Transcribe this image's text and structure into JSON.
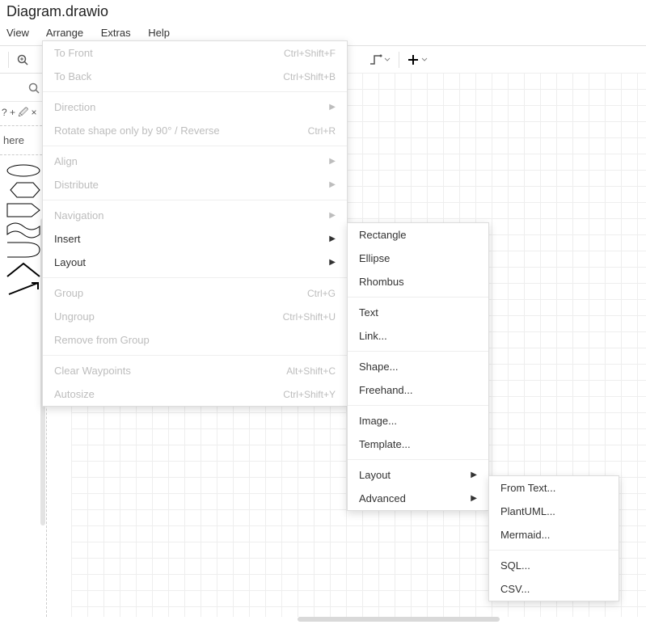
{
  "title": "Diagram.drawio",
  "menubar": [
    "View",
    "Arrange",
    "Extras",
    "Help"
  ],
  "sidebar": {
    "qrow": "? + 🖉 ×",
    "here": "here"
  },
  "menu1": [
    {
      "label": "To Front",
      "short": "Ctrl+Shift+F",
      "disabled": true
    },
    {
      "label": "To Back",
      "short": "Ctrl+Shift+B",
      "disabled": true
    },
    {
      "sep": true
    },
    {
      "label": "Direction",
      "sub": true,
      "disabled": true
    },
    {
      "label": "Rotate shape only by 90° / Reverse",
      "short": "Ctrl+R",
      "disabled": true
    },
    {
      "sep": true
    },
    {
      "label": "Align",
      "sub": true,
      "disabled": true
    },
    {
      "label": "Distribute",
      "sub": true,
      "disabled": true
    },
    {
      "sep": true
    },
    {
      "label": "Navigation",
      "sub": true,
      "disabled": true
    },
    {
      "label": "Insert",
      "sub": true,
      "disabled": false
    },
    {
      "label": "Layout",
      "sub": true,
      "disabled": false
    },
    {
      "sep": true
    },
    {
      "label": "Group",
      "short": "Ctrl+G",
      "disabled": true
    },
    {
      "label": "Ungroup",
      "short": "Ctrl+Shift+U",
      "disabled": true
    },
    {
      "label": "Remove from Group",
      "disabled": true
    },
    {
      "sep": true
    },
    {
      "label": "Clear Waypoints",
      "short": "Alt+Shift+C",
      "disabled": true
    },
    {
      "label": "Autosize",
      "short": "Ctrl+Shift+Y",
      "disabled": true
    }
  ],
  "menu2": [
    {
      "label": "Rectangle"
    },
    {
      "label": "Ellipse"
    },
    {
      "label": "Rhombus"
    },
    {
      "sep": true
    },
    {
      "label": "Text"
    },
    {
      "label": "Link..."
    },
    {
      "sep": true
    },
    {
      "label": "Shape..."
    },
    {
      "label": "Freehand..."
    },
    {
      "sep": true
    },
    {
      "label": "Image..."
    },
    {
      "label": "Template..."
    },
    {
      "sep": true
    },
    {
      "label": "Layout",
      "sub": true
    },
    {
      "label": "Advanced",
      "sub": true
    }
  ],
  "menu3": [
    {
      "label": "From Text..."
    },
    {
      "label": "PlantUML..."
    },
    {
      "label": "Mermaid..."
    },
    {
      "sep": true
    },
    {
      "label": "SQL..."
    },
    {
      "label": "CSV..."
    }
  ]
}
